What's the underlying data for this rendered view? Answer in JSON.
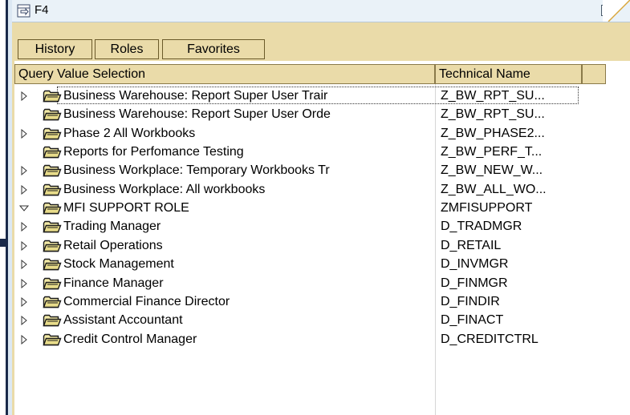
{
  "window": {
    "title": "F4"
  },
  "tabs": [
    {
      "label": "History"
    },
    {
      "label": "Roles"
    },
    {
      "label": "Favorites"
    }
  ],
  "table": {
    "headers": {
      "query": "Query Value Selection",
      "technical": "Technical Name"
    },
    "rows": [
      {
        "label": "Business Warehouse: Report Super User Trair",
        "technical": "Z_BW_RPT_SU...",
        "toggle": "collapsed",
        "focused": true
      },
      {
        "label": "Business Warehouse: Report Super User Orde",
        "technical": "Z_BW_RPT_SU...",
        "toggle": "none"
      },
      {
        "label": "Phase 2 All Workbooks",
        "technical": "Z_BW_PHASE2...",
        "toggle": "collapsed"
      },
      {
        "label": "Reports for Perfomance Testing",
        "technical": "Z_BW_PERF_T...",
        "toggle": "none"
      },
      {
        "label": "Business Workplace: Temporary Workbooks Tr",
        "technical": "Z_BW_NEW_W...",
        "toggle": "collapsed"
      },
      {
        "label": "Business Workplace:  All workbooks",
        "technical": "Z_BW_ALL_WO...",
        "toggle": "collapsed"
      },
      {
        "label": "MFI SUPPORT ROLE",
        "technical": "ZMFISUPPORT",
        "toggle": "expanded"
      },
      {
        "label": "Trading Manager",
        "technical": "D_TRADMGR",
        "toggle": "collapsed"
      },
      {
        "label": "Retail Operations",
        "technical": "D_RETAIL",
        "toggle": "collapsed"
      },
      {
        "label": "Stock Management",
        "technical": "D_INVMGR",
        "toggle": "collapsed"
      },
      {
        "label": "Finance Manager",
        "technical": "D_FINMGR",
        "toggle": "collapsed"
      },
      {
        "label": "Commercial Finance Director",
        "technical": "D_FINDIR",
        "toggle": "collapsed"
      },
      {
        "label": "Assistant Accountant",
        "technical": "D_FINACT",
        "toggle": "collapsed"
      },
      {
        "label": "Credit Control Manager",
        "technical": "D_CREDITCTRL",
        "toggle": "collapsed"
      }
    ]
  },
  "icons": {
    "window": "f4-help-icon",
    "close": "close-icon",
    "folder": "folder-icon",
    "collapsed": "triangle-right-icon",
    "expanded": "triangle-down-icon"
  },
  "colors": {
    "frame": "#eadba9",
    "titlebar": "#eaf2f8",
    "folder_fill": "#f2e9a6"
  }
}
